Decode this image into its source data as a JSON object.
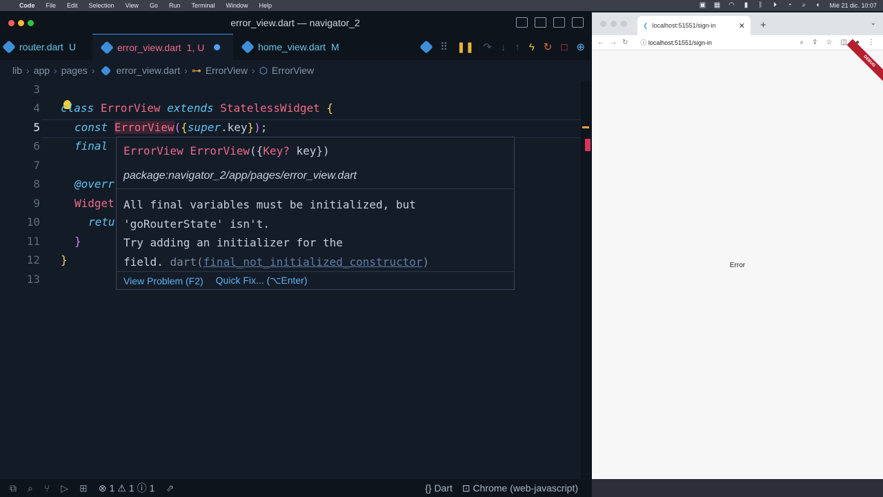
{
  "menubar": {
    "items": [
      "Code",
      "File",
      "Edit",
      "Selection",
      "View",
      "Go",
      "Run",
      "Terminal",
      "Window",
      "Help"
    ],
    "datetime": "Mié 21 dic.  10:07"
  },
  "vscode": {
    "title": "error_view.dart — navigator_2",
    "tabs": [
      {
        "name": "router.dart",
        "status": "U",
        "color": "#69c4e8"
      },
      {
        "name": "error_view.dart",
        "status": "1, U",
        "color": "#f06a8a"
      },
      {
        "name": "home_view.dart",
        "status": "M",
        "color": "#69c4e8"
      }
    ],
    "breadcrumbs": [
      "lib",
      "app",
      "pages",
      "error_view.dart",
      "ErrorView",
      "ErrorView"
    ],
    "line_numbers": [
      "3",
      "4",
      "5",
      "6",
      "7",
      "8",
      "9",
      "10",
      "11",
      "12",
      "13"
    ],
    "code": {
      "l4_class": "class",
      "l4_name": "ErrorView",
      "l4_extends": "extends",
      "l4_super": "StatelessWidget",
      "l4_brace": "{",
      "l5_const": "const",
      "l5_name": "ErrorView",
      "l5_open": "(",
      "l5_lbrace": "{",
      "l5_super": "super",
      "l5_key": ".key",
      "l5_rbrace": "}",
      "l5_close": ")",
      ";": ";",
      "l6_final": "final",
      "l8_anno": "@overr",
      "l9_widget": "Widget",
      "l10_ret": "retu",
      "l11_brace": "}",
      "l12_brace": "}"
    },
    "hover": {
      "sig_name": "ErrorView",
      "sig_fn": "ErrorView",
      "sig_open": "({",
      "sig_type": "Key?",
      "sig_param": " key",
      "sig_close": "})",
      "package": "package:navigator_2/app/pages/error_view.dart",
      "msg_line1": "All final variables must be initialized, but",
      "msg_line2": "'goRouterState' isn't.",
      "msg_line3": "Try adding an initializer for the",
      "msg_line4_a": "field. ",
      "msg_line4_b": "dart(",
      "msg_link": "final_not_initialized_constructor",
      "msg_line4_c": ")",
      "view_problem": "View Problem (F2)",
      "quick_fix": "Quick Fix... (⌥Enter)"
    },
    "status": {
      "errors": "1",
      "warnings": "1",
      "infos": "1",
      "language": "Dart",
      "device": "Chrome (web-javascript)"
    }
  },
  "chrome": {
    "tab_title": "localhost:51551/sign-in",
    "url": "localhost:51551/sign-in",
    "debug_ribbon": "DEBUG",
    "page_text": "Error"
  }
}
